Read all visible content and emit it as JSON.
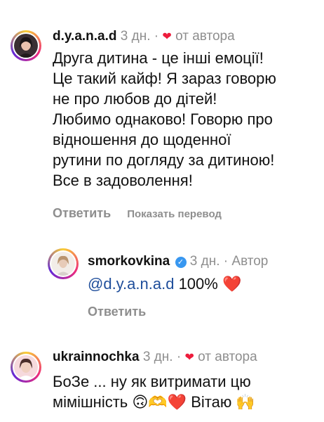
{
  "comments": [
    {
      "username": "d.y.a.n.a.d",
      "time": "3 дн.",
      "separator": "·",
      "heart": "❤",
      "badge": "от автора",
      "lines": [
        "Друга дитина - це інші емоції!",
        "Це такий кайф! Я зараз говорю",
        "не про любов до дітей!",
        "Любимо однаково! Говорю про",
        "відношення до щоденної",
        "рутини по догляду за дитиною!",
        "Все в задоволення!"
      ],
      "reply_label": "Ответить",
      "translate_label": "Показать перевод"
    },
    {
      "username": "smorkovkina",
      "verified_mark": "✓",
      "time": "3 дн.",
      "separator": "·",
      "badge": "Автор",
      "mention": "@d.y.a.n.a.d",
      "text": " 100% ",
      "heart": "❤️",
      "reply_label": "Ответить"
    },
    {
      "username": "ukrainnochka",
      "time": "3 дн.",
      "separator": "·",
      "heart": "❤",
      "badge": "от автора",
      "lines": [
        "БоЗе ... ну як витримати цю",
        "мімішність 🙃🫶❤️ Вітаю 🙌"
      ]
    }
  ],
  "colors": {
    "heart": "#ed1c3c",
    "mention": "#1f4e9b",
    "meta": "#8e8e8e",
    "verified": "#3897f0"
  }
}
